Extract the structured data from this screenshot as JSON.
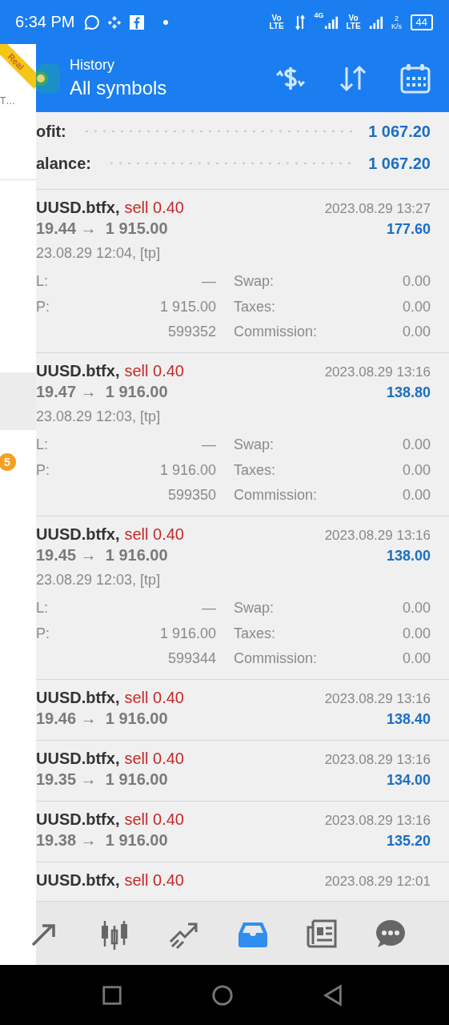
{
  "status_bar": {
    "time": "6:34 PM",
    "network_labels": [
      "Vo LTE",
      "4G",
      "Vo LTE"
    ],
    "speed": "2 K/s",
    "battery": "44"
  },
  "drawer": {
    "badge": "Real",
    "item_text": "T…",
    "count": "5",
    "highlighted_item": true
  },
  "app_bar": {
    "title": "History",
    "subtitle": "All symbols"
  },
  "summary": [
    {
      "label": "ofit:",
      "value": "1 067.20"
    },
    {
      "label": "alance:",
      "value": "1 067.20"
    }
  ],
  "deals": [
    {
      "expanded": true,
      "symbol": "UUSD.btfx,",
      "type": "sell 0.40",
      "open_price": "19.44",
      "arrow": "→",
      "close_price": "1 915.00",
      "time": "2023.08.29 13:27",
      "profit": "177.60",
      "open_time": "23.08.29 12:04, [tp]",
      "details": [
        {
          "label": "L:",
          "value": "—",
          "label2": "Swap:",
          "value2": "0.00"
        },
        {
          "label": "P:",
          "value": "1 915.00",
          "label2": "Taxes:",
          "value2": "0.00"
        },
        {
          "value": "599352",
          "label2": "Commission:",
          "value2": "0.00"
        }
      ]
    },
    {
      "expanded": true,
      "symbol": "UUSD.btfx,",
      "type": "sell 0.40",
      "open_price": "19.47",
      "arrow": "→",
      "close_price": "1 916.00",
      "time": "2023.08.29 13:16",
      "profit": "138.80",
      "open_time": "23.08.29 12:03, [tp]",
      "details": [
        {
          "label": "L:",
          "value": "—",
          "label2": "Swap:",
          "value2": "0.00"
        },
        {
          "label": "P:",
          "value": "1 916.00",
          "label2": "Taxes:",
          "value2": "0.00"
        },
        {
          "value": "599350",
          "label2": "Commission:",
          "value2": "0.00"
        }
      ]
    },
    {
      "expanded": true,
      "symbol": "UUSD.btfx,",
      "type": "sell 0.40",
      "open_price": "19.45",
      "arrow": "→",
      "close_price": "1 916.00",
      "time": "2023.08.29 13:16",
      "profit": "138.00",
      "open_time": "23.08.29 12:03, [tp]",
      "details": [
        {
          "label": "L:",
          "value": "—",
          "label2": "Swap:",
          "value2": "0.00"
        },
        {
          "label": "P:",
          "value": "1 916.00",
          "label2": "Taxes:",
          "value2": "0.00"
        },
        {
          "value": "599344",
          "label2": "Commission:",
          "value2": "0.00"
        }
      ]
    },
    {
      "expanded": false,
      "symbol": "UUSD.btfx,",
      "type": "sell 0.40",
      "open_price": "19.46",
      "arrow": "→",
      "close_price": "1 916.00",
      "time": "2023.08.29 13:16",
      "profit": "138.40"
    },
    {
      "expanded": false,
      "symbol": "UUSD.btfx,",
      "type": "sell 0.40",
      "open_price": "19.35",
      "arrow": "→",
      "close_price": "1 916.00",
      "time": "2023.08.29 13:16",
      "profit": "134.00"
    },
    {
      "expanded": false,
      "symbol": "UUSD.btfx,",
      "type": "sell 0.40",
      "open_price": "19.38",
      "arrow": "→",
      "close_price": "1 916.00",
      "time": "2023.08.29 13:16",
      "profit": "135.20"
    },
    {
      "expanded": false,
      "symbol": "UUSD.btfx,",
      "type": "sell 0.40",
      "time": "2023.08.29 12:01"
    }
  ],
  "bottom_nav": [
    {
      "selected": false
    },
    {
      "selected": false
    },
    {
      "selected": false
    },
    {
      "selected": true
    },
    {
      "selected": false
    },
    {
      "selected": false
    }
  ]
}
